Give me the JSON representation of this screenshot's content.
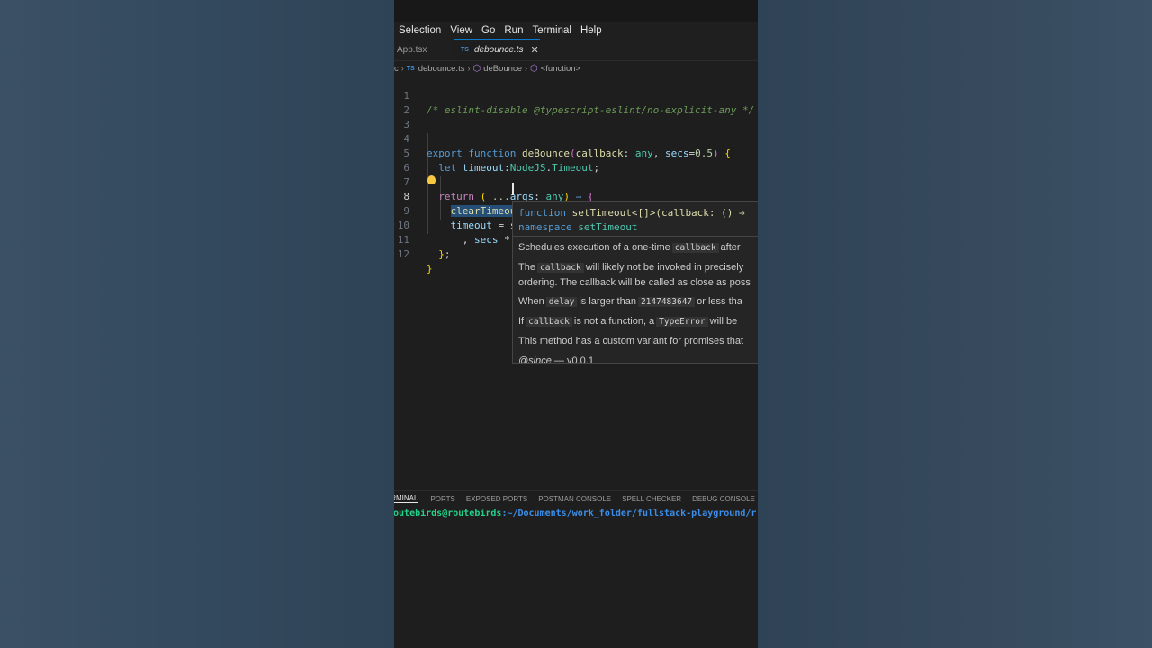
{
  "menubar": {
    "items": [
      "Selection",
      "View",
      "Go",
      "Run",
      "Terminal",
      "Help"
    ]
  },
  "tabs": [
    {
      "label": "App.tsx",
      "active": false
    },
    {
      "label": "debounce.ts",
      "active": true,
      "icon": "TS"
    }
  ],
  "breadcrumb": {
    "root": "c",
    "file": "debounce.ts",
    "symbol": "deBounce",
    "scope": "<function>"
  },
  "code_lines": [
    {
      "n": "1",
      "text": "/* eslint-disable @typescript-eslint/no-explicit-any */"
    },
    {
      "n": "2",
      "text": ""
    },
    {
      "n": "3",
      "text": ""
    },
    {
      "n": "4",
      "text": "export function deBounce(callback: any, secs=0.5) {"
    },
    {
      "n": "5",
      "text": "  let timeout:NodeJS.Timeout;"
    },
    {
      "n": "6",
      "text": ""
    },
    {
      "n": "7",
      "text": "  return ( ...args: any) => {"
    },
    {
      "n": "8",
      "text": "    clearTimeout(timeout);"
    },
    {
      "n": "9",
      "text": "    timeout = setTimeout( () => callback( ...args)"
    },
    {
      "n": "10",
      "text": "      , secs * "
    },
    {
      "n": "11",
      "text": "  };"
    },
    {
      "n": "12",
      "text": "}"
    }
  ],
  "hover": {
    "sig_line1_kw": "function",
    "sig_line1_rest": "setTimeout<[]>(callback: () ⇒",
    "sig_line2_kw": "namespace",
    "sig_line2_rest": "setTimeout",
    "doc_1a": "Schedules execution of a one-time",
    "doc_1_code": "callback",
    "doc_1b": "after",
    "doc_2a": "The",
    "doc_2_code": "callback",
    "doc_2b": "will likely not be invoked in precisely",
    "doc_3": "ordering. The callback will be called as close as poss",
    "doc_4a": "When",
    "doc_4_code1": "delay",
    "doc_4b": "is larger than",
    "doc_4_code2": "2147483647",
    "doc_4c": "or less tha",
    "doc_5a": "If",
    "doc_5_code1": "callback",
    "doc_5b": "is not a function, a",
    "doc_5_code2": "TypeError",
    "doc_5c": "will be",
    "doc_6": "This method has a custom variant for promises that",
    "since_tag": "@since",
    "since_val": "— v0.0.1"
  },
  "panel": {
    "tabs": [
      "TERMINAL",
      "PORTS",
      "EXPOSED PORTS",
      "POSTMAN CONSOLE",
      "SPELL CHECKER",
      "DEBUG CONSOLE"
    ],
    "active_tab": "TERMINAL",
    "terminal_user": "routebirds@routebirds",
    "terminal_path": ":~/Documents/work_folder/fullstack-playground/r"
  },
  "colors": {
    "background": "#34475a",
    "editor": "#1e1e1e",
    "accent": "#0a7acc",
    "selection": "#264f78"
  }
}
